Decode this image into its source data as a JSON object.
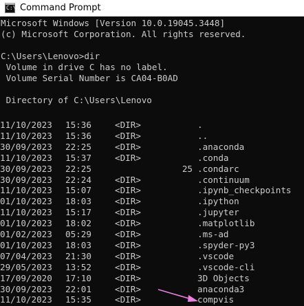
{
  "window": {
    "title": "Command Prompt",
    "icon": "cmd-icon",
    "icon_glyph": "C:\\"
  },
  "console": {
    "header_lines": [
      "Microsoft Windows [Version 10.0.19045.3448]",
      "(c) Microsoft Corporation. All rights reserved.",
      "",
      "C:\\Users\\Lenovo>dir",
      " Volume in drive C has no label.",
      " Volume Serial Number is CA04-B0AD",
      "",
      " Directory of C:\\Users\\Lenovo",
      ""
    ],
    "entries": [
      {
        "date": "11/10/2023",
        "time": "15:36",
        "type": "<DIR>",
        "size": "",
        "name": "."
      },
      {
        "date": "11/10/2023",
        "time": "15:36",
        "type": "<DIR>",
        "size": "",
        "name": ".."
      },
      {
        "date": "30/09/2023",
        "time": "22:25",
        "type": "<DIR>",
        "size": "",
        "name": ".anaconda"
      },
      {
        "date": "11/10/2023",
        "time": "15:37",
        "type": "<DIR>",
        "size": "",
        "name": ".conda"
      },
      {
        "date": "30/09/2023",
        "time": "22:25",
        "type": "",
        "size": "25",
        "name": ".condarc"
      },
      {
        "date": "30/09/2023",
        "time": "22:24",
        "type": "<DIR>",
        "size": "",
        "name": ".continuum"
      },
      {
        "date": "11/10/2023",
        "time": "15:07",
        "type": "<DIR>",
        "size": "",
        "name": ".ipynb_checkpoints"
      },
      {
        "date": "01/10/2023",
        "time": "18:03",
        "type": "<DIR>",
        "size": "",
        "name": ".ipython"
      },
      {
        "date": "11/10/2023",
        "time": "15:17",
        "type": "<DIR>",
        "size": "",
        "name": ".jupyter"
      },
      {
        "date": "01/10/2023",
        "time": "18:02",
        "type": "<DIR>",
        "size": "",
        "name": ".matplotlib"
      },
      {
        "date": "01/02/2023",
        "time": "05:29",
        "type": "<DIR>",
        "size": "",
        "name": ".ms-ad"
      },
      {
        "date": "01/10/2023",
        "time": "18:03",
        "type": "<DIR>",
        "size": "",
        "name": ".spyder-py3"
      },
      {
        "date": "07/04/2023",
        "time": "21:30",
        "type": "<DIR>",
        "size": "",
        "name": ".vscode"
      },
      {
        "date": "29/05/2023",
        "time": "13:52",
        "type": "<DIR>",
        "size": "",
        "name": ".vscode-cli"
      },
      {
        "date": "17/09/2020",
        "time": "17:10",
        "type": "<DIR>",
        "size": "",
        "name": "3D Objects"
      },
      {
        "date": "30/09/2023",
        "time": "22:01",
        "type": "<DIR>",
        "size": "",
        "name": "anaconda3"
      },
      {
        "date": "11/10/2023",
        "time": "15:35",
        "type": "<DIR>",
        "size": "",
        "name": "compvis"
      }
    ]
  },
  "colors": {
    "console_bg": "#0c0c0c",
    "console_text": "#cccccc",
    "titlebar_bg": "#ffffff",
    "arrow": "#ee7fe2"
  },
  "annotation": {
    "icon": "arrow-icon",
    "target_entry": "compvis"
  }
}
